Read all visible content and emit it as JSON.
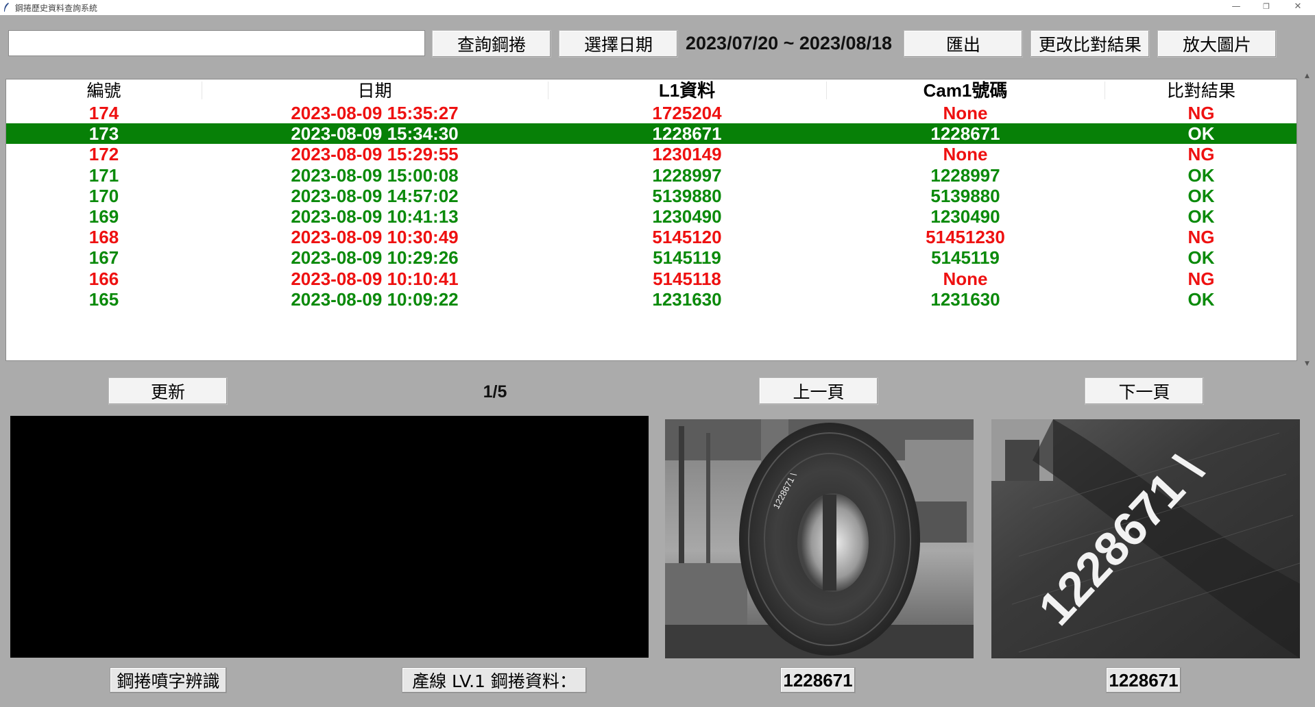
{
  "window": {
    "title": "鋼捲歷史資料查詢系統",
    "minimize_glyph": "—",
    "restore_glyph": "❐",
    "close_glyph": "✕"
  },
  "toolbar": {
    "search_value": "",
    "query_label": "查詢鋼捲",
    "select_date_label": "選擇日期",
    "date_range": "2023/07/20 ~ 2023/08/18",
    "export_label": "匯出",
    "change_result_label": "更改比對結果",
    "zoom_label": "放大圖片"
  },
  "table": {
    "headers": [
      "編號",
      "日期",
      "L1資料",
      "Cam1號碼",
      "比對結果"
    ],
    "selected_index": 1,
    "rows": [
      {
        "id": "174",
        "date": "2023-08-09 15:35:27",
        "l1": "1725204",
        "cam1": "None",
        "result": "NG",
        "status": "ng"
      },
      {
        "id": "173",
        "date": "2023-08-09 15:34:30",
        "l1": "1228671",
        "cam1": "1228671",
        "result": "OK",
        "status": "ok"
      },
      {
        "id": "172",
        "date": "2023-08-09 15:29:55",
        "l1": "1230149",
        "cam1": "None",
        "result": "NG",
        "status": "ng"
      },
      {
        "id": "171",
        "date": "2023-08-09 15:00:08",
        "l1": "1228997",
        "cam1": "1228997",
        "result": "OK",
        "status": "ok"
      },
      {
        "id": "170",
        "date": "2023-08-09 14:57:02",
        "l1": "5139880",
        "cam1": "5139880",
        "result": "OK",
        "status": "ok"
      },
      {
        "id": "169",
        "date": "2023-08-09 10:41:13",
        "l1": "1230490",
        "cam1": "1230490",
        "result": "OK",
        "status": "ok"
      },
      {
        "id": "168",
        "date": "2023-08-09 10:30:49",
        "l1": "5145120",
        "cam1": "51451230",
        "result": "NG",
        "status": "ng"
      },
      {
        "id": "167",
        "date": "2023-08-09 10:29:26",
        "l1": "5145119",
        "cam1": "5145119",
        "result": "OK",
        "status": "ok"
      },
      {
        "id": "166",
        "date": "2023-08-09 10:10:41",
        "l1": "5145118",
        "cam1": "None",
        "result": "NG",
        "status": "ng"
      },
      {
        "id": "165",
        "date": "2023-08-09 10:09:22",
        "l1": "1231630",
        "cam1": "1231630",
        "result": "OK",
        "status": "ok"
      }
    ]
  },
  "pagination": {
    "refresh_label": "更新",
    "page_info": "1/5",
    "prev_label": "上一頁",
    "next_label": "下一頁"
  },
  "bottom": {
    "recognition_label": "鋼捲噴字辨識",
    "l1_data_label": "產線 LV.1 鋼捲資料：",
    "cam1_number": "1228671",
    "cam1_closeup_number": "1228671",
    "coil_stamp_text": "1228671 \\"
  },
  "colors": {
    "ng": "#ee1111",
    "ok": "#0b8a0b",
    "selected_row_bg": "#078007",
    "selected_row_text": "#ffffff",
    "background": "#ababab"
  }
}
